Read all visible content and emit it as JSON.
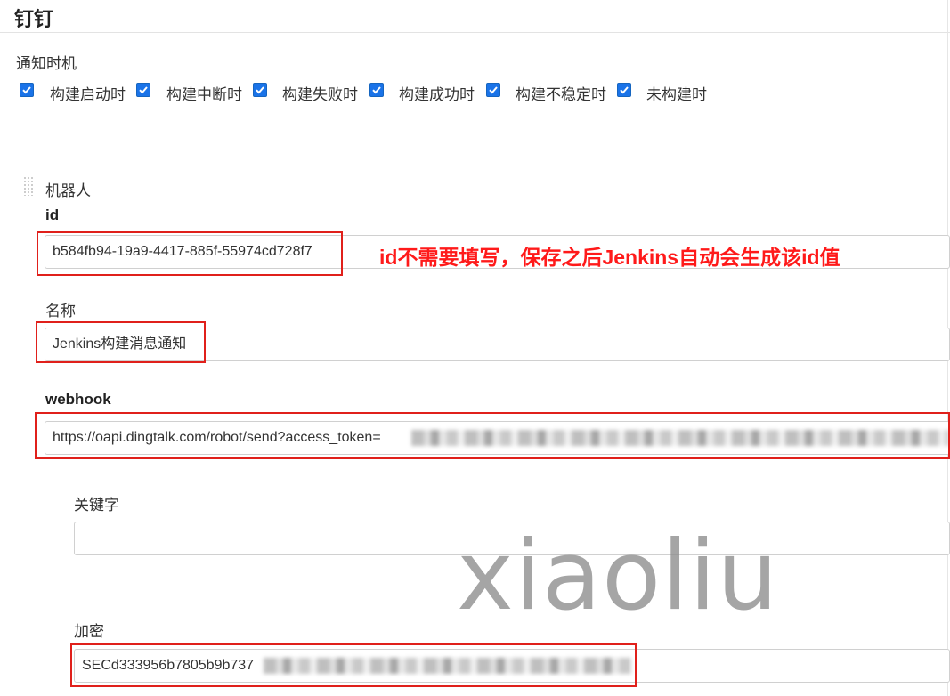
{
  "section": {
    "title": "钉钉"
  },
  "notify": {
    "label": "通知时机",
    "options": [
      {
        "label": "构建启动时",
        "checked": true
      },
      {
        "label": "构建中断时",
        "checked": true
      },
      {
        "label": "构建失败时",
        "checked": true
      },
      {
        "label": "构建成功时",
        "checked": true
      },
      {
        "label": "构建不稳定时",
        "checked": true
      },
      {
        "label": "未构建时",
        "checked": true
      }
    ]
  },
  "robot": {
    "label": "机器人",
    "id_label": "id",
    "id_value": "b584fb94-19a9-4417-885f-55974cd728f7",
    "annotation": "id不需要填写，保存之后Jenkins自动会生成该id值",
    "name_label": "名称",
    "name_value": "Jenkins构建消息通知",
    "webhook_label": "webhook",
    "webhook_value": "https://oapi.dingtalk.com/robot/send?access_token=",
    "keyword_label": "关键字",
    "keyword_value": "",
    "secret_label": "加密",
    "secret_value": "SECd333956b7805b9b737"
  },
  "watermark": "xiaoliu",
  "colors": {
    "accent": "#1a73e8",
    "annotation": "#ff1a1a",
    "highlight_box": "#e0201b"
  }
}
